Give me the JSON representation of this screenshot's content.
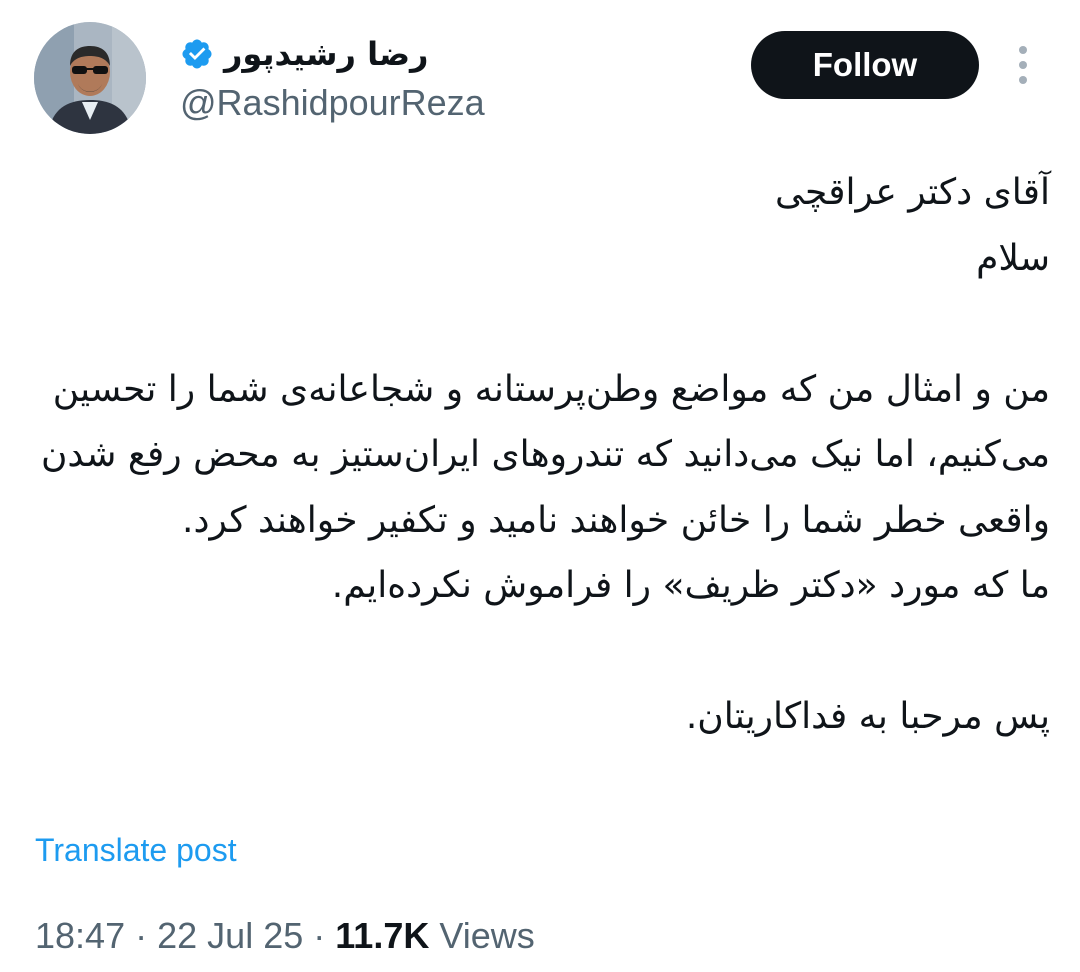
{
  "author": {
    "display_name": "رضا رشیدپور",
    "handle": "@RashidpourReza",
    "verified_icon": "verified-badge-icon",
    "avatar_icon": "profile-photo"
  },
  "actions": {
    "follow_label": "Follow",
    "more_icon": "more-vertical-icon"
  },
  "body": {
    "paragraphs": [
      "آقای دکتر عراقچی\nسلام",
      "من و امثال من که مواضع وطن‌پرستانه و شجاعانه‌ی شما را تحسین می‌کنیم، اما نیک می‌دانید که تندروهای ایران‌ستیز به محض رفع شدن واقعی خطر شما را خائن خواهند نامید و تکفیر خواهند کرد.\nما که مورد «دکتر ظریف» را فراموش نکرده‌ایم.",
      "پس مرحبا به فداکاریتان."
    ]
  },
  "translate_label": "Translate post",
  "meta": {
    "time": "18:47",
    "separator": "·",
    "date": "22 Jul 25",
    "views_count": "11.7K",
    "views_label": "Views"
  },
  "colors": {
    "text": "#0f1419",
    "secondary": "#536471",
    "link": "#1d9bf0",
    "verified": "#1d9bf0",
    "button": "#0f1419"
  }
}
